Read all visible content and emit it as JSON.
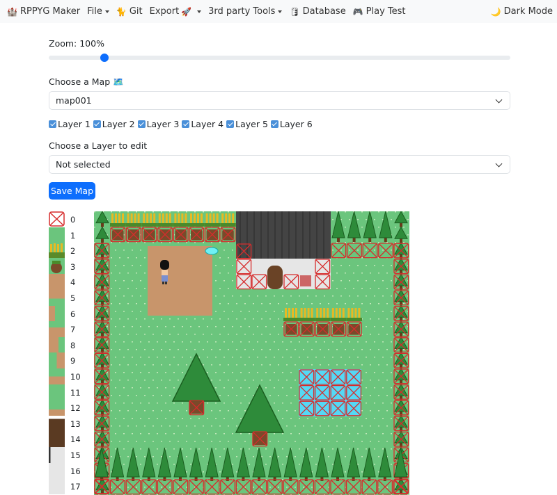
{
  "navbar": {
    "brand_icon": "castle-icon",
    "brand": "RPPYG Maker",
    "file": "File",
    "git_icon": "git-icon",
    "git": "Git",
    "export": "Export",
    "export_icon": "rocket-icon",
    "third_party": "3rd party Tools",
    "database_icon": "database-icon",
    "database": "Database",
    "playtest_icon": "gamepad-icon",
    "playtest": "Play Test",
    "darkmode_icon": "moon-icon",
    "darkmode": "Dark Mode"
  },
  "zoom": {
    "label": "Zoom: 100%",
    "value_percent": 100,
    "slider_fraction": 0.12
  },
  "map_select": {
    "label": "Choose a Map",
    "label_icon": "map-icon",
    "value": "map001"
  },
  "layers": [
    {
      "label": "Layer 1",
      "checked": true
    },
    {
      "label": "Layer 2",
      "checked": true
    },
    {
      "label": "Layer 3",
      "checked": true
    },
    {
      "label": "Layer 4",
      "checked": true
    },
    {
      "label": "Layer 5",
      "checked": true
    },
    {
      "label": "Layer 6",
      "checked": true
    }
  ],
  "layer_select": {
    "label": "Choose a Layer to edit",
    "value": "Not selected"
  },
  "save_button": "Save Map",
  "palette": {
    "indices": [
      "0",
      "1",
      "2",
      "3",
      "4",
      "5",
      "6",
      "7",
      "8",
      "9",
      "10",
      "11",
      "12",
      "13",
      "14",
      "15",
      "16",
      "17"
    ]
  },
  "colors": {
    "primary": "#0d6efd",
    "grass": "#6bc57d",
    "dirt": "#c8956b",
    "tree": "#2e8b3a",
    "roof": "#444444",
    "wall": "#e6e6e6",
    "water": "#55d8f5",
    "collision": "#d62c2c"
  }
}
